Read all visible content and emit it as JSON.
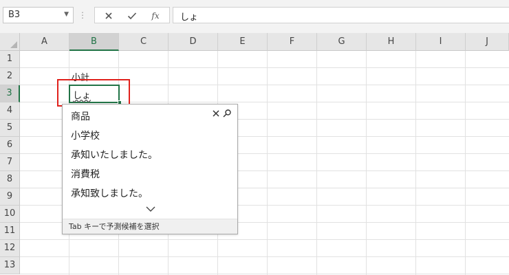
{
  "formula_bar": {
    "name_box": "B3",
    "cancel_symbol": "✕",
    "enter_symbol": "✓",
    "fx_label": "fx",
    "formula_value": "しょ"
  },
  "columns": [
    "A",
    "B",
    "C",
    "D",
    "E",
    "F",
    "G",
    "H",
    "I",
    "J"
  ],
  "rows": [
    "1",
    "2",
    "3",
    "4",
    "5",
    "6",
    "7",
    "8",
    "9",
    "10",
    "11",
    "12",
    "13"
  ],
  "active": {
    "column": "B",
    "row": "3"
  },
  "cells": {
    "b2": "小計",
    "b3": "しょ"
  },
  "autocomplete": {
    "suggestions": [
      "商品",
      "小学校",
      "承知いたしました。",
      "消費税",
      "承知致しました。"
    ],
    "footer_hint": "Tab キーで予測候補を選択"
  },
  "colors": {
    "accent_green": "#217346",
    "highlight_red": "#e0201b"
  }
}
